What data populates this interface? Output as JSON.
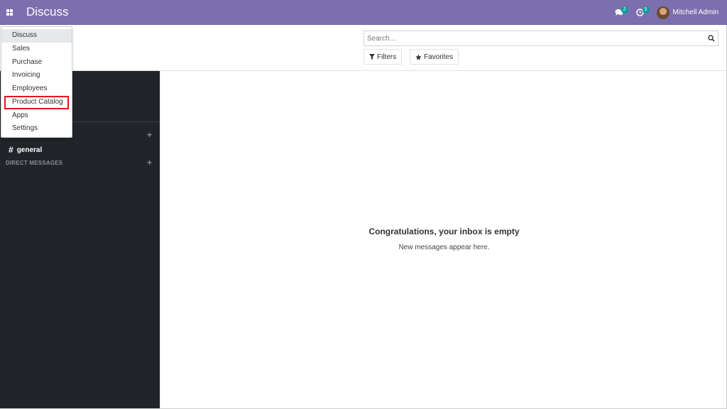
{
  "navbar": {
    "app_title": "Discuss",
    "messages_count": "2",
    "activities_count": "5",
    "user_name": "Mitchell Admin",
    "bg_color": "#7c6fad"
  },
  "control_panel": {
    "search_placeholder": "Search...",
    "filters_label": "Filters",
    "favorites_label": "Favorites"
  },
  "apps_menu": {
    "items": [
      {
        "label": "Discuss",
        "active": true
      },
      {
        "label": "Sales"
      },
      {
        "label": "Purchase"
      },
      {
        "label": "Invoicing"
      },
      {
        "label": "Employees"
      },
      {
        "label": "Product Catalog",
        "highlighted": true,
        "highlight_color": "#e8141b"
      },
      {
        "label": "Apps"
      },
      {
        "label": "Settings"
      }
    ]
  },
  "sidebar": {
    "channel_name": "general",
    "direct_messages_title": "DIRECT MESSAGES",
    "bg_color": "#212529"
  },
  "main": {
    "empty_title": "Congratulations, your inbox is empty",
    "empty_subtitle": "New messages appear here."
  }
}
